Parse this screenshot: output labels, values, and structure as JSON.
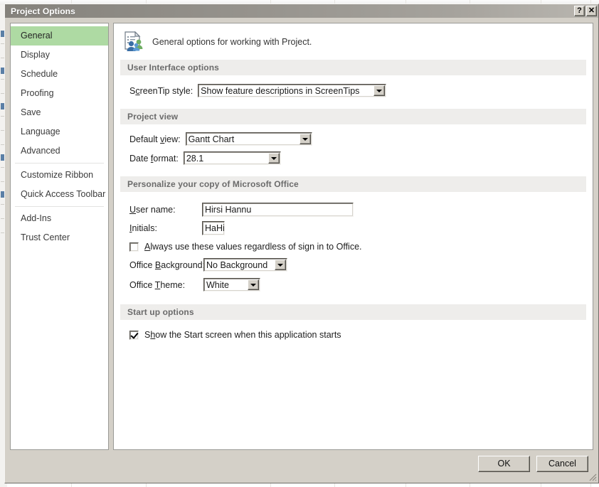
{
  "window": {
    "title": "Project Options",
    "help_button": "?",
    "close_button": "✕",
    "help_icon_name": "help-icon",
    "close_icon_name": "close-icon"
  },
  "sidebar": {
    "items": [
      {
        "label": "General",
        "selected": true
      },
      {
        "label": "Display",
        "selected": false
      },
      {
        "label": "Schedule",
        "selected": false
      },
      {
        "label": "Proofing",
        "selected": false
      },
      {
        "label": "Save",
        "selected": false
      },
      {
        "label": "Language",
        "selected": false
      },
      {
        "label": "Advanced",
        "selected": false
      },
      {
        "label": "Customize Ribbon",
        "selected": false
      },
      {
        "label": "Quick Access Toolbar",
        "selected": false
      },
      {
        "label": "Add-Ins",
        "selected": false
      },
      {
        "label": "Trust Center",
        "selected": false
      }
    ]
  },
  "pane": {
    "header_text": "General options for working with Project.",
    "header_icon": "document-people-icon"
  },
  "sections": {
    "user_interface": {
      "title": "User Interface options",
      "screentip": {
        "label_pre": "S",
        "label_accel": "c",
        "label_post": "reenTip style:",
        "value": "Show feature descriptions in ScreenTips"
      }
    },
    "project_view": {
      "title": "Project view",
      "default_view": {
        "label_pre": "Default ",
        "label_accel": "v",
        "label_post": "iew:",
        "value": "Gantt Chart"
      },
      "date_format": {
        "label_pre": "Date ",
        "label_accel": "f",
        "label_post": "ormat:",
        "value": "28.1"
      }
    },
    "personalize": {
      "title": "Personalize your copy of Microsoft Office",
      "user_name": {
        "label_pre": "",
        "label_accel": "U",
        "label_post": "ser name:",
        "value": "Hirsi Hannu"
      },
      "initials": {
        "label_pre": "",
        "label_accel": "I",
        "label_post": "nitials:",
        "value": "HaHi"
      },
      "always_use": {
        "text_pre": "",
        "text_accel": "A",
        "text_post": "lways use these values regardless of sign in to Office.",
        "checked": false
      },
      "office_background": {
        "label_pre": "Office ",
        "label_accel": "B",
        "label_post": "ackground:",
        "value": "No Background"
      },
      "office_theme": {
        "label_pre": "Office ",
        "label_accel": "T",
        "label_post": "heme:",
        "value": "White"
      }
    },
    "startup": {
      "title": "Start up options",
      "show_start_screen": {
        "text_pre": "S",
        "text_accel": "h",
        "text_post": "ow the Start screen when this application starts",
        "checked": true
      }
    }
  },
  "footer": {
    "ok_label": "OK",
    "cancel_label": "Cancel"
  },
  "colors": {
    "selected_nav": "#aedaa3",
    "section_header_bg": "#eeedeb",
    "dialog_face": "#d4d0c8",
    "titlebar_start": "#85827c",
    "titlebar_end": "#b9b6b0"
  }
}
